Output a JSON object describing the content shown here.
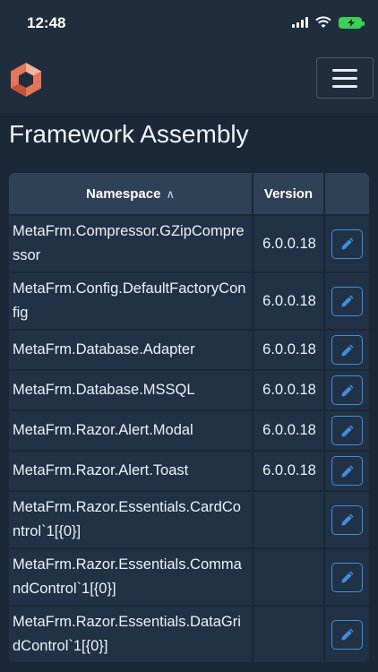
{
  "status_bar": {
    "time": "12:48"
  },
  "page": {
    "title": "Framework Assembly"
  },
  "table": {
    "columns": [
      {
        "label": "Namespace",
        "sort_indicator": "∧"
      },
      {
        "label": "Version"
      },
      {
        "label": ""
      }
    ],
    "rows": [
      {
        "namespace": "MetaFrm.Compressor.GZipCompressor",
        "version": "6.0.0.18"
      },
      {
        "namespace": "MetaFrm.Config.DefaultFactoryConfig",
        "version": "6.0.0.18"
      },
      {
        "namespace": "MetaFrm.Database.Adapter",
        "version": "6.0.0.18"
      },
      {
        "namespace": "MetaFrm.Database.MSSQL",
        "version": "6.0.0.18"
      },
      {
        "namespace": "MetaFrm.Razor.Alert.Modal",
        "version": "6.0.0.18"
      },
      {
        "namespace": "MetaFrm.Razor.Alert.Toast",
        "version": "6.0.0.18"
      },
      {
        "namespace": "MetaFrm.Razor.Essentials.CardControl`1[{0}]",
        "version": ""
      },
      {
        "namespace": "MetaFrm.Razor.Essentials.CommandControl`1[{0}]",
        "version": ""
      },
      {
        "namespace": "MetaFrm.Razor.Essentials.DataGridControl`1[{0}]",
        "version": ""
      }
    ]
  },
  "colors": {
    "background": "#1b2838",
    "header": "#2f4156",
    "row": "#213246",
    "accent": "#3f8fdf"
  }
}
